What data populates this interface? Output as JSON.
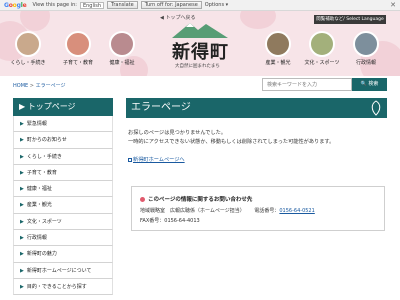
{
  "translate_bar": {
    "brand": "Google",
    "view_text": "View this page in:",
    "language": "English",
    "translate_button": "Translate",
    "turn_off": "Turn off for: Japanese",
    "options": "Options ▾"
  },
  "header": {
    "top_link": "トップへ戻る",
    "logo_title": "新得町",
    "logo_subtitle": "大自然に囲まれたまち",
    "language_button": "閲覧補助など/ Select Language"
  },
  "nav": [
    {
      "label": "くらし・手続き",
      "color": "#c9a98c"
    },
    {
      "label": "子育て・教育",
      "color": "#d88f7c"
    },
    {
      "label": "健康・福祉",
      "color": "#b98b8f"
    },
    {
      "label": "産業・観光",
      "color": "#8f7a5e"
    },
    {
      "label": "文化・スポーツ",
      "color": "#a3b07b"
    },
    {
      "label": "行政情報",
      "color": "#7d8f9c"
    }
  ],
  "breadcrumb": {
    "home": "HOME",
    "sep": ">",
    "current": "エラーページ"
  },
  "search": {
    "placeholder": "検索キーワードを入力",
    "button": "検索"
  },
  "sidebar": {
    "heading": "トップページ",
    "items": [
      "緊急情報",
      "町からのお知らせ",
      "くらし・手続き",
      "子育て・教育",
      "健康・福祉",
      "産業・観光",
      "文化・スポーツ",
      "行政情報",
      "新得町の魅力",
      "新得町ホームページについて",
      "目的・できることから探す"
    ]
  },
  "main": {
    "heading": "エラーページ",
    "message1": "お探しのページは見つかりませんでした。",
    "message2": "一時的にアクセスできない状態か、移動もしくは削除されてしまった可能性があります。",
    "home_link": "新得町ホームページへ"
  },
  "contact": {
    "title": "このページの情報に関するお問い合わせ先",
    "dept": "地域戦略室　広報広聴係（ホームページ担当）",
    "tel_label": "電話番号：",
    "tel": "0156-64-0521",
    "fax": "FAX番号：0156-64-4013"
  },
  "colors": {
    "accent": "#1a6669",
    "header_bg": "#f7e4e8",
    "link": "#1a5aa0"
  }
}
